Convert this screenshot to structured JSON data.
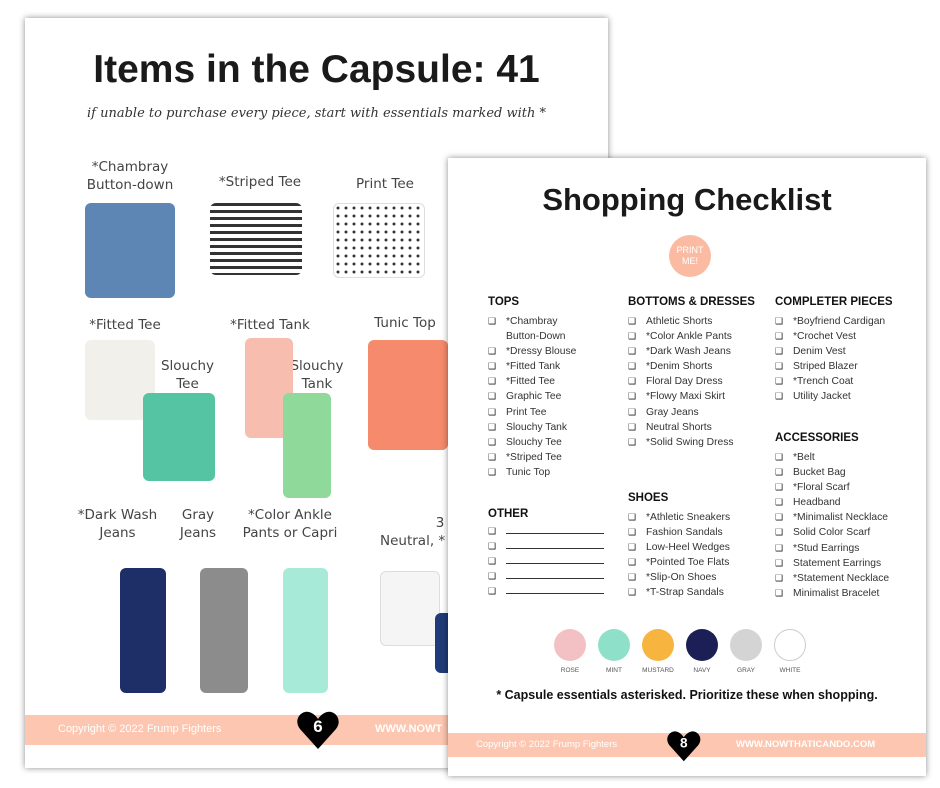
{
  "page1": {
    "title": "Items in the Capsule: 41",
    "subtitle": "if unable to purchase every piece, start with essentials marked with *",
    "labels": [
      "*Chambray Button-down",
      "*Striped Tee",
      "Print Tee",
      "*Fitted Tee",
      "*Fitted Tank",
      "Tunic Top",
      "Slouchy Tee",
      "Slouchy Tank",
      "*Dark Wash Jeans",
      "Gray Jeans",
      "*Color Ankle Pants or Capri",
      "3",
      "Neutral, *"
    ],
    "copyright": "Copyright © 2022 Frump Fighters",
    "page_number": "6",
    "website": "WWW.NOWT"
  },
  "page2": {
    "title": "Shopping Checklist",
    "print_button": "PRINT ME!",
    "sections": {
      "tops": {
        "heading": "TOPS",
        "items": [
          "*Chambray Button-Down",
          "*Dressy Blouse",
          "*Fitted Tank",
          "*Fitted Tee",
          "Graphic Tee",
          "Print Tee",
          "Slouchy Tank",
          "Slouchy Tee",
          "*Striped Tee",
          "Tunic Top"
        ]
      },
      "other": {
        "heading": "OTHER",
        "items": [
          "",
          "",
          "",
          "",
          ""
        ]
      },
      "bottoms": {
        "heading": "BOTTOMS & DRESSES",
        "items": [
          "Athletic Shorts",
          "*Color Ankle Pants",
          "*Dark Wash Jeans",
          "*Denim Shorts",
          "Floral Day Dress",
          "*Flowy Maxi Skirt",
          "Gray Jeans",
          "Neutral Shorts",
          "*Solid Swing Dress"
        ]
      },
      "shoes": {
        "heading": "SHOES",
        "items": [
          "*Athletic Sneakers",
          "Fashion Sandals",
          "Low-Heel Wedges",
          "*Pointed Toe Flats",
          "*Slip-On Shoes",
          "*T-Strap Sandals"
        ]
      },
      "completer": {
        "heading": "COMPLETER PIECES",
        "items": [
          "*Boyfriend Cardigan",
          "*Crochet Vest",
          "Denim Vest",
          "Striped Blazer",
          "*Trench Coat",
          "Utility Jacket"
        ]
      },
      "accessories": {
        "heading": "ACCESSORIES",
        "items": [
          "*Belt",
          "Bucket Bag",
          "*Floral Scarf",
          "Headband",
          "*Minimalist Necklace",
          "Solid Color Scarf",
          "*Stud Earrings",
          "Statement Earrings",
          "*Statement Necklace",
          "Minimalist Bracelet"
        ]
      }
    },
    "palette": [
      {
        "name": "ROSE",
        "color": "#f3c1c3"
      },
      {
        "name": "MINT",
        "color": "#8fe0c8"
      },
      {
        "name": "MUSTARD",
        "color": "#f7b53f"
      },
      {
        "name": "NAVY",
        "color": "#1b1f55"
      },
      {
        "name": "GRAY",
        "color": "#d4d4d4"
      },
      {
        "name": "WHITE",
        "color": "#ffffff"
      }
    ],
    "note": "* Capsule essentials asterisked. Prioritize these when shopping.",
    "copyright": "Copyright © 2022 Frump Fighters",
    "page_number": "8",
    "website": "WWW.NOWTHATICANDO.COM"
  }
}
